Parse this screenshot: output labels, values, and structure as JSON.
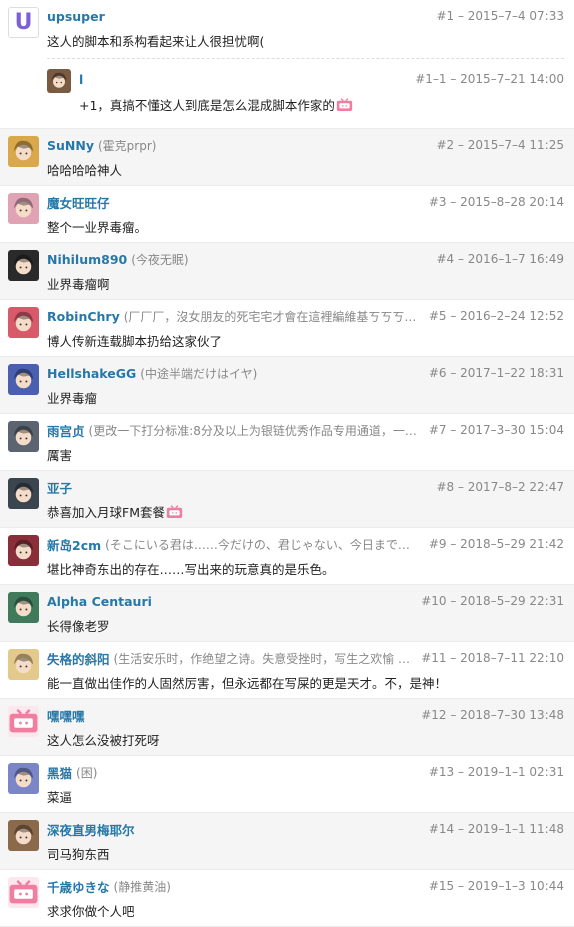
{
  "posts": [
    {
      "name": "upsuper",
      "sign": "",
      "meta": "#1 – 2015–7–4 07:33",
      "body": "这人的脚本和系构看起来让人很担忧啊(",
      "avatar": {
        "icon": "u-letter-avatar",
        "color": "#ffffff"
      },
      "reply": {
        "name": "l",
        "meta": "#1–1 – 2015–7–21 14:00",
        "body": "+1，真搞不懂这人到底是怎么混成脚本作家的",
        "emoji": "bilibili-tv-emoji-icon",
        "avatar": {
          "icon": "anime-avatar",
          "color": "#7a5a40"
        }
      }
    },
    {
      "name": "SuNNy",
      "sign": "(霍克prpr)",
      "meta": "#2 – 2015–7–4 11:25",
      "body": "哈哈哈哈神人",
      "avatar": {
        "icon": "anime-avatar",
        "color": "#d9a84a"
      }
    },
    {
      "name": "魔女旺旺仔",
      "sign": "",
      "meta": "#3 – 2015–8–28 20:14",
      "body": "整个一业界毒瘤。",
      "avatar": {
        "icon": "anime-avatar",
        "color": "#e0a3b4"
      }
    },
    {
      "name": "Nihilum890",
      "sign": "(今夜无眠)",
      "meta": "#4 – 2016–1–7 16:49",
      "body": "业界毒瘤啊",
      "avatar": {
        "icon": "anime-avatar",
        "color": "#2a2a2a"
      }
    },
    {
      "name": "RobinChry",
      "sign": "(厂厂厂，沒女朋友的死宅宅才會在這裡編維基ㄎㄎㄎㄎㄎ ...)",
      "meta": "#5 – 2016–2–24 12:52",
      "body": "博人传新连载脚本扔给这家伙了",
      "avatar": {
        "icon": "anime-avatar",
        "color": "#d85a6a"
      }
    },
    {
      "name": "HellshakeGG",
      "sign": "(中途半端だけはイヤ)",
      "meta": "#6 – 2017–1–22 18:31",
      "body": "业界毒瘤",
      "avatar": {
        "icon": "anime-avatar",
        "color": "#4a5fb0"
      }
    },
    {
      "name": "雨宫贞",
      "sign": "(更改一下打分标准:8分及以上为银链优秀作品专用通道，一 ...)",
      "meta": "#7 – 2017–3–30 15:04",
      "body": "厲害",
      "avatar": {
        "icon": "anime-avatar",
        "color": "#5b6470"
      }
    },
    {
      "name": "亚子",
      "sign": "",
      "meta": "#8 – 2017–8–2 22:47",
      "body": "恭喜加入月球FM套餐",
      "emoji": "bilibili-tv-emoji-icon",
      "avatar": {
        "icon": "anime-avatar",
        "color": "#3a4550"
      }
    },
    {
      "name": "新岛2cm",
      "sign": "(そこにいる君は……今だけの、君じゃない、今日までの ...)",
      "meta": "#9 – 2018–5–29 21:42",
      "body": "堪比神奇东出的存在……写出来的玩意真的是乐色。",
      "avatar": {
        "icon": "anime-avatar",
        "color": "#8a2e3a"
      }
    },
    {
      "name": "Alpha Centauri",
      "sign": "",
      "meta": "#10 – 2018–5–29 22:31",
      "body": "长得像老罗",
      "avatar": {
        "icon": "anime-avatar",
        "color": "#3f7a5a"
      }
    },
    {
      "name": "失格的斜阳",
      "sign": "(生活安乐时，作绝望之诗。失意受挫时，写生之欢愉 ... ...)",
      "meta": "#11 – 2018–7–11 22:10",
      "body": "能一直做出佳作的人固然厉害，但永远都在写屎的更是天才。不，是神！",
      "avatar": {
        "icon": "anime-avatar",
        "color": "#e3c98a"
      }
    },
    {
      "name": "嘿嘿嘿",
      "sign": "",
      "meta": "#12 – 2018–7–30 13:48",
      "body": "这人怎么没被打死呀",
      "avatar": {
        "icon": "bilibili-tv-avatar",
        "color": "#f07ea0"
      }
    },
    {
      "name": "黑猫",
      "sign": "(困)",
      "meta": "#13 – 2019–1–1 02:31",
      "body": "菜逼",
      "avatar": {
        "icon": "anime-avatar",
        "color": "#7a86c8"
      }
    },
    {
      "name": "深夜直男梅耶尔",
      "sign": "",
      "meta": "#14 – 2019–1–1 11:48",
      "body": "司马狗东西",
      "avatar": {
        "icon": "anime-avatar",
        "color": "#8a6a4a"
      }
    },
    {
      "name": "千歳ゆきな",
      "sign": "(静推黄油)",
      "meta": "#15 – 2019–1–3 10:44",
      "body": "求求你做个人吧",
      "avatar": {
        "icon": "bilibili-tv-avatar",
        "color": "#f07ea0"
      }
    }
  ]
}
